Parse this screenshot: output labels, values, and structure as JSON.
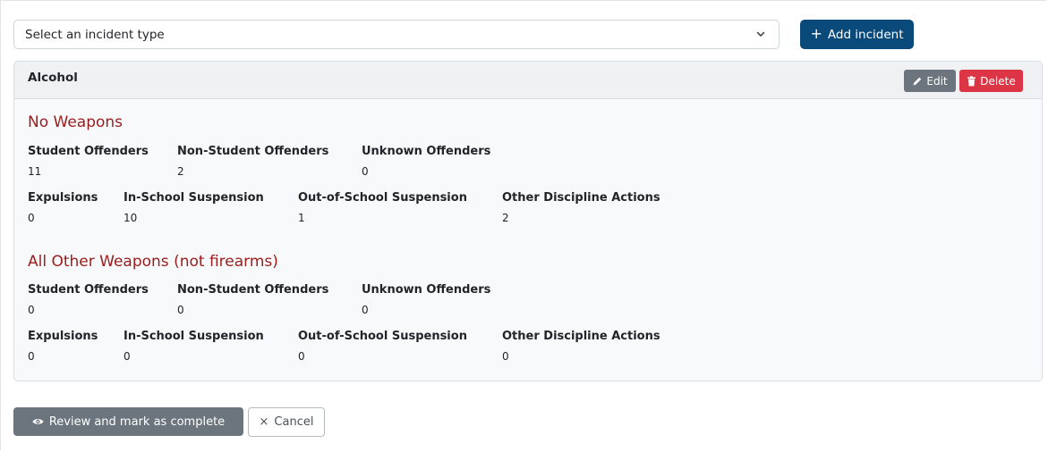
{
  "toolbar": {
    "select_placeholder": "Select an incident type",
    "add_label": "Add incident"
  },
  "card": {
    "title": "Alcohol",
    "edit_label": "Edit",
    "delete_label": "Delete",
    "sections": [
      {
        "title": "No Weapons",
        "offenders": {
          "student_label": "Student Offenders",
          "student_value": "11",
          "nonstudent_label": "Non-Student Offenders",
          "nonstudent_value": "2",
          "unknown_label": "Unknown Offenders",
          "unknown_value": "0"
        },
        "actions": {
          "expulsions_label": "Expulsions",
          "expulsions_value": "0",
          "iss_label": "In-School Suspension",
          "iss_value": "10",
          "oss_label": "Out-of-School Suspension",
          "oss_value": "1",
          "other_label": "Other Discipline Actions",
          "other_value": "2"
        }
      },
      {
        "title": "All Other Weapons (not firearms)",
        "offenders": {
          "student_label": "Student Offenders",
          "student_value": "0",
          "nonstudent_label": "Non-Student Offenders",
          "nonstudent_value": "0",
          "unknown_label": "Unknown Offenders",
          "unknown_value": "0"
        },
        "actions": {
          "expulsions_label": "Expulsions",
          "expulsions_value": "0",
          "iss_label": "In-School Suspension",
          "iss_value": "0",
          "oss_label": "Out-of-School Suspension",
          "oss_value": "0",
          "other_label": "Other Discipline Actions",
          "other_value": "0"
        }
      }
    ]
  },
  "footer": {
    "review_label": "Review and mark as complete",
    "cancel_label": "Cancel"
  },
  "colors": {
    "primary": "#0a4a7a",
    "secondary": "#6c757d",
    "danger": "#dc3545",
    "section_title": "#9b1c1c"
  },
  "icons": {
    "select": "chevron-down-icon",
    "add": "plus-icon",
    "edit": "pencil-icon",
    "delete": "trash-icon",
    "review": "eye-icon",
    "cancel": "close-icon"
  }
}
